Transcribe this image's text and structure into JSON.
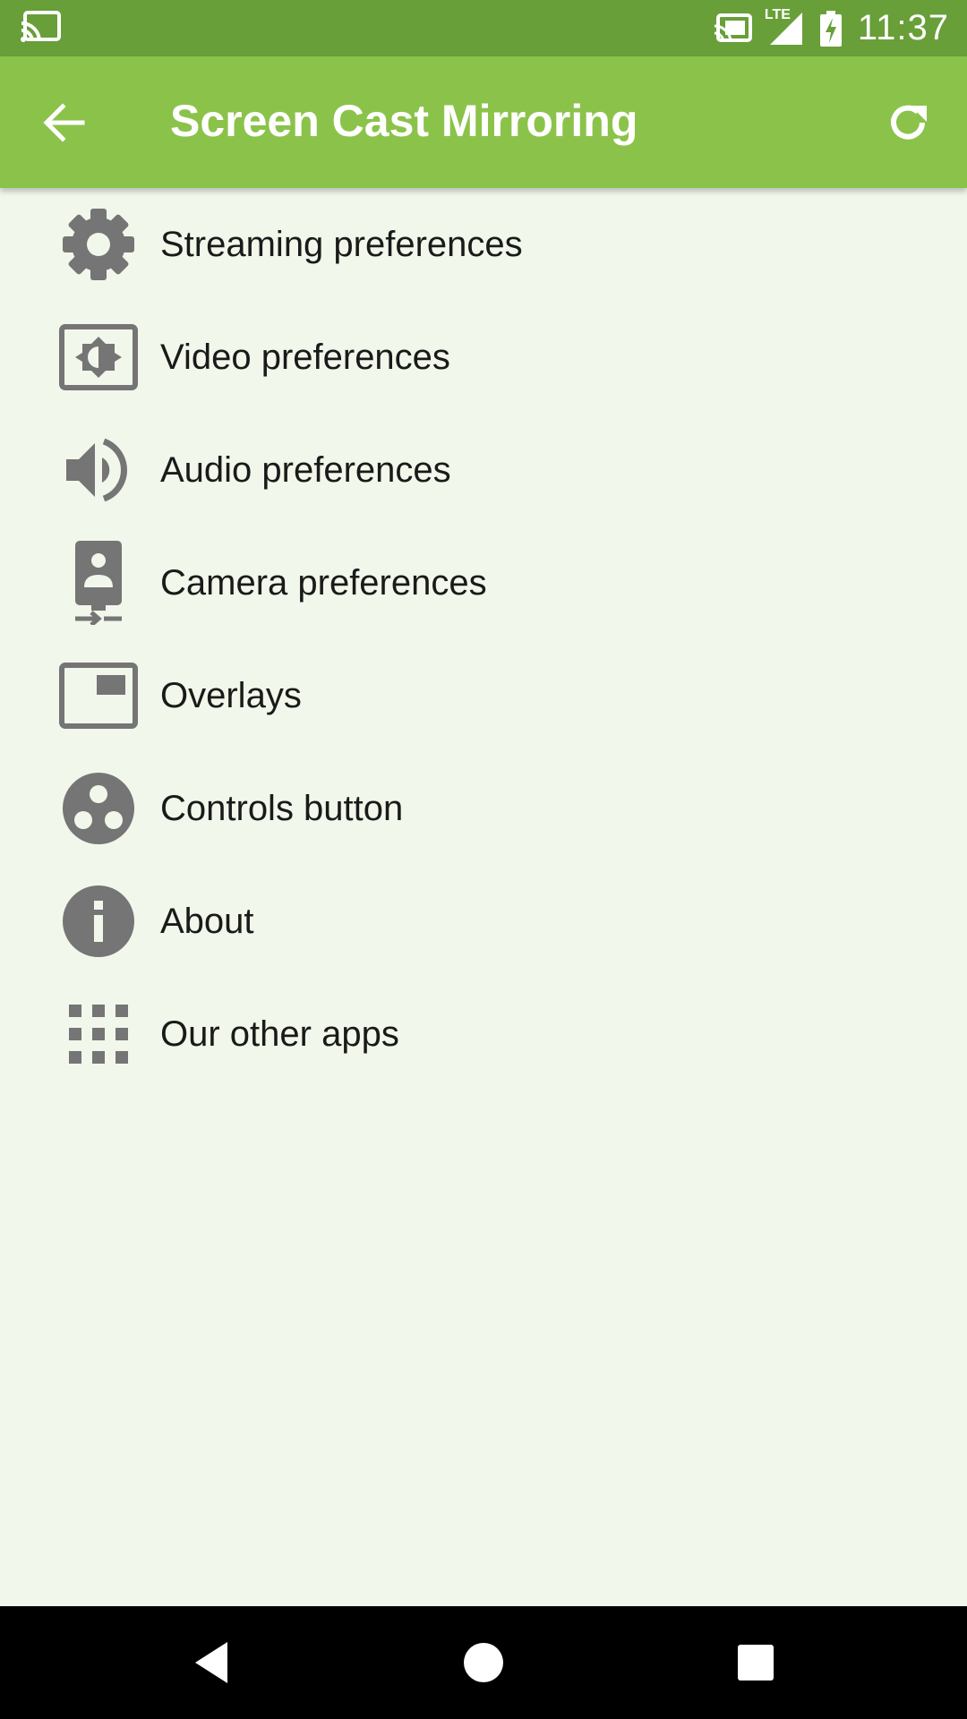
{
  "status_bar": {
    "time": "11:37",
    "network_label": "LTE",
    "icons": [
      "cast-icon",
      "cast-connected-icon",
      "signal-icon",
      "battery-charging-icon"
    ]
  },
  "app_bar": {
    "title": "Screen Cast Mirroring",
    "back_icon": "arrow-back-icon",
    "refresh_icon": "refresh-icon"
  },
  "menu": {
    "items": [
      {
        "label": "Streaming preferences",
        "icon": "gear-icon"
      },
      {
        "label": "Video preferences",
        "icon": "brightness-icon"
      },
      {
        "label": "Audio preferences",
        "icon": "volume-icon"
      },
      {
        "label": "Camera preferences",
        "icon": "camera-front-icon"
      },
      {
        "label": "Overlays",
        "icon": "picture-in-picture-icon"
      },
      {
        "label": "Controls button",
        "icon": "controls-icon"
      },
      {
        "label": "About",
        "icon": "info-icon"
      },
      {
        "label": "Our other apps",
        "icon": "apps-grid-icon"
      }
    ]
  },
  "colors": {
    "status_bar": "#689f38",
    "app_bar": "#8bc34a",
    "background": "#f1f7ea",
    "icon": "#757575",
    "nav_bar": "#000000"
  },
  "nav_bar": {
    "buttons": [
      "back-triangle-icon",
      "home-circle-icon",
      "recents-square-icon"
    ]
  }
}
